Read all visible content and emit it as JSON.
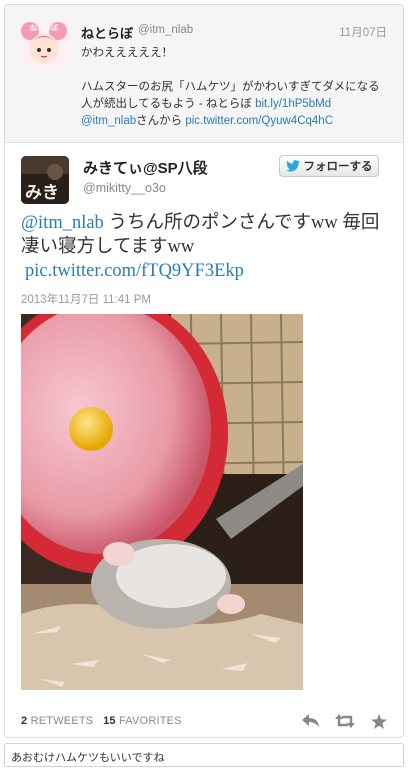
{
  "parent_tweet": {
    "name": "ねとらぼ",
    "handle": "@itm_nlab",
    "date": "11月07日",
    "line1": "かわえええええ！",
    "line2": "ハムスターのお尻「ハムケツ」がかわいすぎてダメになる人が続出してるもよう - ねとらぼ",
    "link1": "bit.ly/1hP5bMd",
    "mention": "@itm_nlab",
    "from_text": "さんから",
    "link2": "pic.twitter.com/Qyuw4Cq4hC"
  },
  "tweet": {
    "name": "みきてぃ@SP八段",
    "handle": "@mikitty__o3o",
    "follow_label": "フォローする",
    "mention": "@itm_nlab",
    "text": " うちん所のポンさんですww 毎回凄い寝方してますww",
    "pic_link": "pic.twitter.com/fTQ9YF3Ekp",
    "timestamp": "2013年11月7日 11:41 PM",
    "retweets_count": "2",
    "retweets_label": "RETWEETS",
    "favorites_count": "15",
    "favorites_label": "FAVORITES"
  },
  "avatars": {
    "parent_avatar_text": "ねとらぼ",
    "tweet_avatar_text": "みき"
  },
  "actions": [
    "reply-icon",
    "retweet-icon",
    "favorite-icon"
  ],
  "caption": "あおむけハムケツもいいですね",
  "colors": {
    "link": "#2b7bb9",
    "wheel": "#e0323c",
    "twitter_bird": "#2aa9e0"
  }
}
